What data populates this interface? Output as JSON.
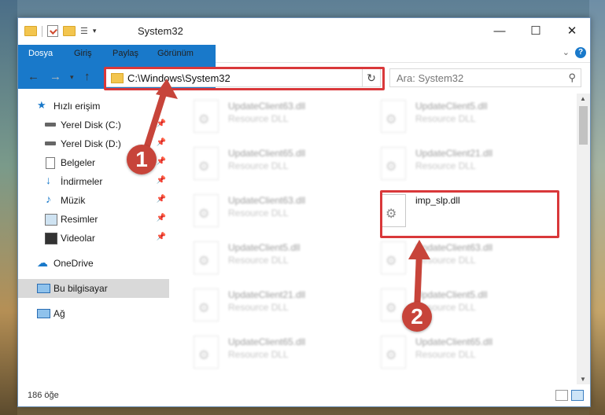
{
  "window": {
    "title": "System32"
  },
  "titlebar": {
    "minimize": "—",
    "maximize": "☐",
    "close": "✕"
  },
  "ribbon": {
    "tabs": [
      "Dosya",
      "Giriş",
      "Paylaş",
      "Görünüm"
    ],
    "help": "?",
    "accent": "#1979ca"
  },
  "address": {
    "path": "C:\\Windows\\System32"
  },
  "search": {
    "placeholder": "Ara: System32"
  },
  "sidebar": {
    "items": [
      {
        "label": "Hızlı erişim",
        "icon": "star-icon",
        "pinned": false
      },
      {
        "label": "Yerel Disk (C:)",
        "icon": "drive-icon",
        "pinned": true
      },
      {
        "label": "Yerel Disk (D:)",
        "icon": "drive-icon",
        "pinned": true
      },
      {
        "label": "Belgeler",
        "icon": "documents-icon",
        "pinned": true
      },
      {
        "label": "İndirmeler",
        "icon": "download-icon",
        "pinned": true
      },
      {
        "label": "Müzik",
        "icon": "music-icon",
        "pinned": true
      },
      {
        "label": "Resimler",
        "icon": "pictures-icon",
        "pinned": true
      },
      {
        "label": "Videolar",
        "icon": "video-icon",
        "pinned": true
      },
      {
        "label": "OneDrive",
        "icon": "cloud-icon",
        "pinned": false
      },
      {
        "label": "Bu bilgisayar",
        "icon": "computer-icon",
        "pinned": false,
        "selected": true
      },
      {
        "label": "Ağ",
        "icon": "network-icon",
        "pinned": false
      }
    ]
  },
  "files": [
    {
      "name": "UpdateClient63.dll",
      "type": "Resource DLL"
    },
    {
      "name": "UpdateClient5.dll",
      "type": "Resource DLL"
    },
    {
      "name": "UpdateClient65.dll",
      "type": "Resource DLL"
    },
    {
      "name": "UpdateClient21.dll",
      "type": "Resource DLL"
    },
    {
      "name": "UpdateClient63.dll",
      "type": "Resource DLL"
    },
    {
      "name": "imp_slp.dll",
      "type": ""
    },
    {
      "name": "UpdateClient5.dll",
      "type": "Resource DLL"
    },
    {
      "name": "UpdateClient63.dll",
      "type": "Resource DLL"
    },
    {
      "name": "UpdateClient21.dll",
      "type": "Resource DLL"
    },
    {
      "name": "UpdateClient5.dll",
      "type": "Resource DLL"
    },
    {
      "name": "UpdateClient65.dll",
      "type": "Resource DLL"
    },
    {
      "name": "UpdateClient65.dll",
      "type": "Resource DLL"
    }
  ],
  "status": {
    "count": "186 öğe"
  },
  "annotations": {
    "step1": "1",
    "step2": "2",
    "highlight_color": "#d9383a"
  }
}
